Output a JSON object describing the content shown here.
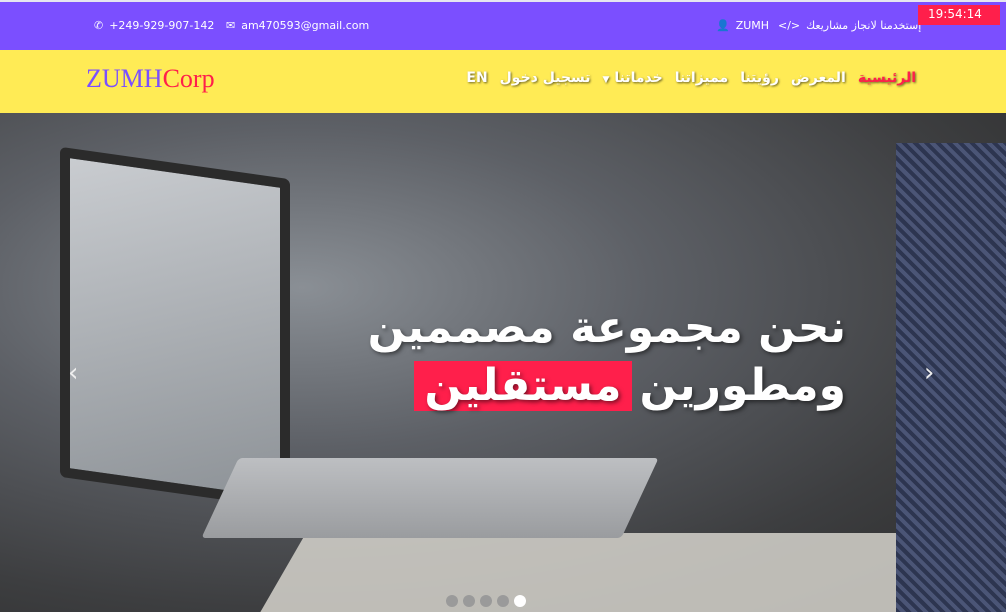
{
  "topbar": {
    "phone": "+249-929-907-142",
    "email": "am470593@gmail.com",
    "user": "ZUMH",
    "tagline": "إستخدمنا لانجاز مشاريعك",
    "clock": "19:54:14"
  },
  "navbar": {
    "logo_a": "ZUMH",
    "logo_b": "Corp",
    "items": [
      "الرئيسية",
      "المعرض",
      "رؤيتنا",
      "مميزاتنا",
      "خدماتنا",
      "تسجيل دخول",
      "EN"
    ]
  },
  "hero": {
    "line1": "نحن مجموعة مصممين",
    "line2": "ومطورين",
    "highlight": "مستقلين",
    "slides": 5,
    "active_slide": 5
  },
  "colors": {
    "purple": "#7b4fff",
    "yellow": "#ffeb55",
    "red": "#ff1f4b"
  }
}
